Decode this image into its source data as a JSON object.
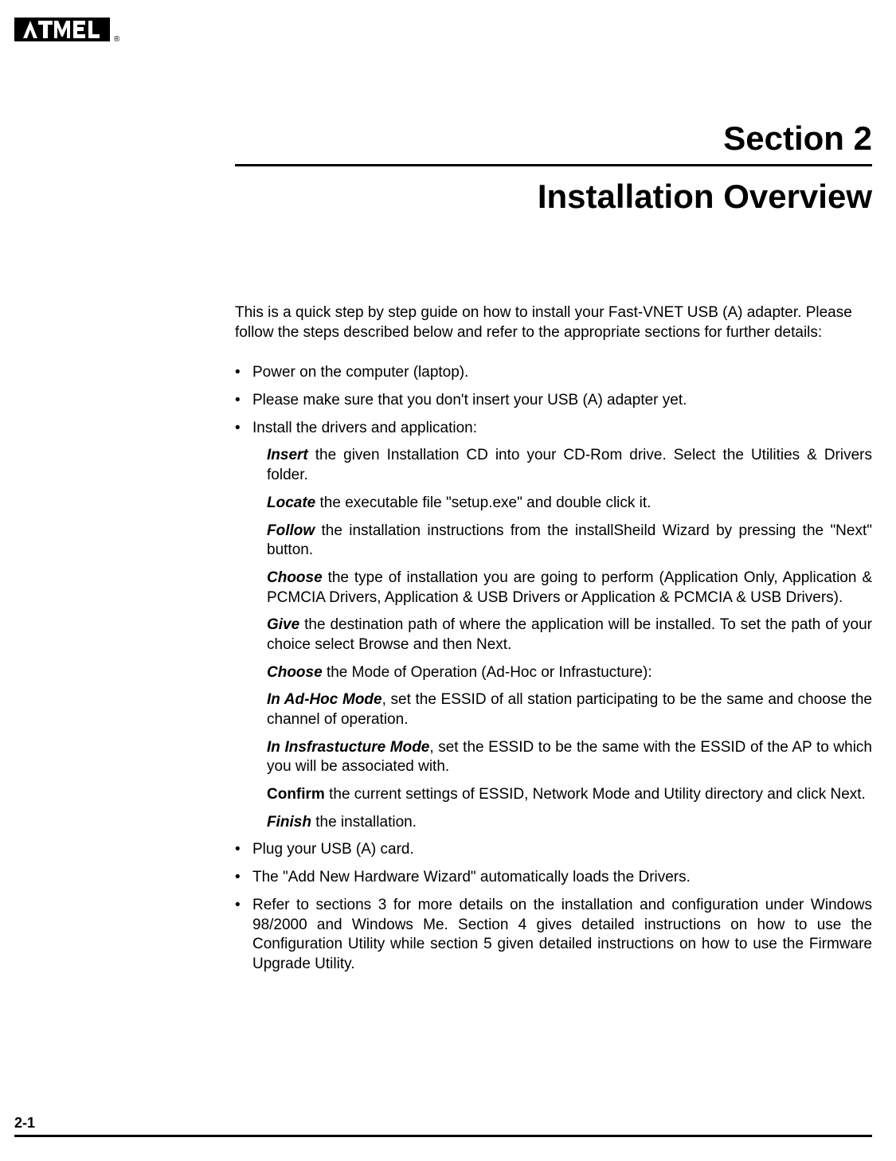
{
  "logo_text": "ATMEL",
  "section_label": "Section 2",
  "section_title": "Installation Overview",
  "intro": "This is a quick step by step guide on how to install your Fast-VNET USB (A) adapter. Please follow the steps described below and refer to the appropriate sections for further details:",
  "bullets": {
    "b1": "Power on the computer (laptop).",
    "b2": "Please make sure that you don't insert your USB (A) adapter yet.",
    "b3": "Install the drivers and application:",
    "b4": "Plug your USB (A) card.",
    "b5": "The \"Add New Hardware Wizard\" automatically loads the Drivers.",
    "b6": "Refer to sections 3 for more details on the installation and configuration under Windows 98/2000 and Windows Me. Section 4 gives detailed instructions on how to use the Configuration Utility while section 5 given detailed instructions on how to use the Firmware Upgrade Utility."
  },
  "sub": {
    "s1": {
      "kw": "Insert",
      "rest": " the given Installation CD into your CD-Rom drive. Select the Utilities & Drivers folder."
    },
    "s2": {
      "kw": "Locate",
      "rest": " the executable file \"setup.exe\" and double click it."
    },
    "s3": {
      "kw": "Follow",
      "rest": " the installation instructions from the installSheild Wizard by pressing the \"Next\" button."
    },
    "s4": {
      "kw": "Choose",
      "rest": " the type of installation you are going to perform (Application Only, Application & PCMCIA Drivers, Application & USB Drivers or Application & PCMCIA & USB Drivers)."
    },
    "s5": {
      "kw": "Give",
      "rest": " the destination path of where the application will be installed. To set the path of your choice select Browse and then Next."
    },
    "s6": {
      "kw": "Choose",
      "rest": " the Mode of Operation (Ad-Hoc or Infrastucture):"
    },
    "s7": {
      "kw": "In Ad-Hoc Mode",
      "rest": ", set the ESSID of all station participating to be the same and choose the channel of operation."
    },
    "s8": {
      "kw": "In Insfrastucture Mode",
      "rest": ", set the ESSID to be the same with the ESSID of the AP to which you will be associated with."
    },
    "s9": {
      "kw": "Confirm",
      "rest": " the current settings of ESSID, Network Mode and Utility directory and click Next."
    },
    "s10": {
      "kw": "Finish",
      "rest": " the installation."
    }
  },
  "page_number": "2-1"
}
